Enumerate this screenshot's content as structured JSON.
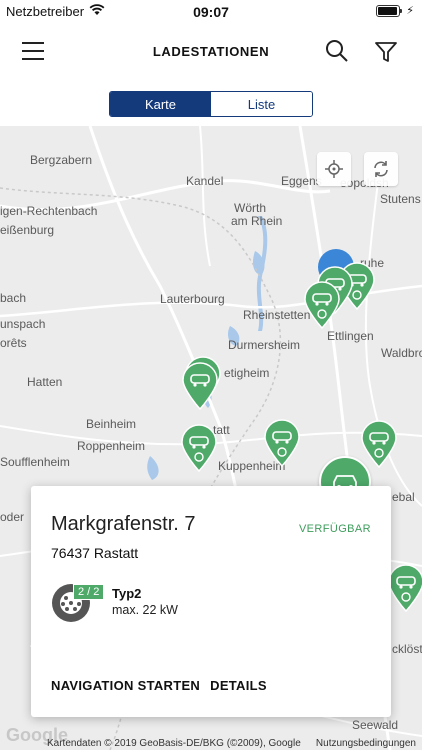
{
  "status": {
    "carrier": "Netzbetreiber",
    "time": "09:07",
    "battery_level": 0.95
  },
  "nav": {
    "title": "LADESTATIONEN"
  },
  "segments": [
    {
      "label": "Karte",
      "active": true
    },
    {
      "label": "Liste",
      "active": false
    }
  ],
  "map": {
    "places": [
      {
        "id": "bergzabern",
        "label": "Bergzabern"
      },
      {
        "id": "kandel",
        "label": "Kandel"
      },
      {
        "id": "eggenstein",
        "label": "Eggens"
      },
      {
        "id": "leopold",
        "label": "eopoldsh"
      },
      {
        "id": "stutensee",
        "label": "Stutens"
      },
      {
        "id": "rechtenbach",
        "label": "igen-Rechtenbach"
      },
      {
        "id": "woerth",
        "label": "Wörth"
      },
      {
        "id": "amrhein",
        "label": "am Rhein"
      },
      {
        "id": "eissenburg",
        "label": "eißenburg"
      },
      {
        "id": "ruhe",
        "label": "ruhe"
      },
      {
        "id": "bach",
        "label": "bach"
      },
      {
        "id": "lauterbourg",
        "label": "Lauterbourg"
      },
      {
        "id": "rheinstetten",
        "label": "Rheinstetten"
      },
      {
        "id": "ettlingen",
        "label": "Ettlingen"
      },
      {
        "id": "unspach",
        "label": "unspach"
      },
      {
        "id": "durmersheim",
        "label": "Durmersheim"
      },
      {
        "id": "waldbronn",
        "label": "Waldbro"
      },
      {
        "id": "orets",
        "label": "orêts"
      },
      {
        "id": "bietigheim",
        "label": "etigheim"
      },
      {
        "id": "hatten",
        "label": "Hatten"
      },
      {
        "id": "beinheim",
        "label": "Beinheim"
      },
      {
        "id": "roppenheim",
        "label": "Roppenheim"
      },
      {
        "id": "rastatt",
        "label": "tatt"
      },
      {
        "id": "soufflenheim",
        "label": "Soufflenheim"
      },
      {
        "id": "kuppenheim",
        "label": "Kuppenheim"
      },
      {
        "id": "oder",
        "label": "oder"
      },
      {
        "id": "ebal",
        "label": "ebal"
      },
      {
        "id": "cklost",
        "label": "cklöst"
      },
      {
        "id": "seewald",
        "label": "Seewald"
      }
    ]
  },
  "card": {
    "street": "Markgrafenstr. 7",
    "city": "76437 Rastatt",
    "status": "VERFÜGBAR",
    "plug_badge": "2 / 2",
    "plug_type": "Typ2",
    "plug_power": "max. 22 kW",
    "action_navigation": "NAVIGATION STARTEN",
    "action_details": "DETAILS"
  },
  "footer": {
    "google": "Google",
    "attribution": "Kartendaten © 2019 GeoBasis-DE/BKG (©2009), Google",
    "terms": "Nutzungsbedingungen"
  },
  "colors": {
    "accent": "#143a7c",
    "available": "#4faa6a",
    "cluster": "#3b86d6"
  }
}
